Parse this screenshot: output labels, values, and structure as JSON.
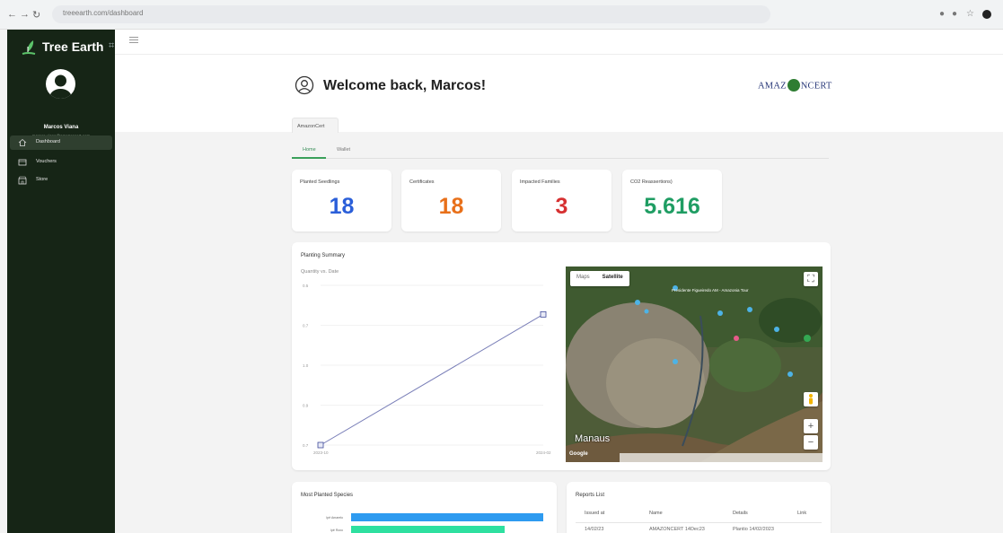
{
  "browser": {
    "url": "treeearth.com/dashboard"
  },
  "sidebar": {
    "app_name": "Tree Earth",
    "user_name": "Marcos Viana",
    "user_email": "marcos.viana@amazoncert.com",
    "items": [
      {
        "label": "Dashboard",
        "icon": "home-icon",
        "active": true
      },
      {
        "label": "Vouchers",
        "icon": "voucher-icon",
        "active": false
      },
      {
        "label": "Store",
        "icon": "store-icon",
        "active": false
      }
    ]
  },
  "header": {
    "welcome": "Welcome back, Marcos!",
    "company_logo_left": "AMAZ",
    "company_logo_right": "NCERT",
    "company_tab": "AmazonCert"
  },
  "tabs": [
    "Home",
    "Wallet"
  ],
  "stats": [
    {
      "label": "Planted Seedlings",
      "value": "18",
      "color": "#2b5fd9"
    },
    {
      "label": "Certificates",
      "value": "18",
      "color": "#e8701a"
    },
    {
      "label": "Impacted Families",
      "value": "3",
      "color": "#d63031"
    },
    {
      "label": "CO2 Reassertions)",
      "value": "5.616",
      "color": "#1f9d63"
    }
  ],
  "planting_summary": {
    "title": "Planting Summary",
    "chart_subtitle": "Quantity vs. Date"
  },
  "chart_data": {
    "type": "line",
    "title": "Quantity vs. Date",
    "x": [
      "2023-10",
      "2024-02"
    ],
    "y_ticks": [
      "0.5",
      "0.7",
      "1.0",
      "0.9",
      "0.7"
    ],
    "series": [
      {
        "values": [
          0,
          18
        ]
      }
    ],
    "ylim": [
      0,
      22
    ],
    "grid": true
  },
  "map": {
    "map_label": "Maps",
    "satellite_label": "Satellite",
    "city_label": "Manaus",
    "google_label": "Google",
    "places": [
      "Presidente Figueiredo AM - Amazonia Tour",
      "Manaus"
    ]
  },
  "species": {
    "title": "Most Planted Species",
    "bars": [
      {
        "label": "Ipê Amarelo",
        "value": 10,
        "color": "#2e9bf0"
      },
      {
        "label": "Ipê Roxo",
        "value": 8,
        "color": "#2ee0a0"
      }
    ]
  },
  "reports": {
    "title": "Reports List",
    "columns": [
      "Issued at",
      "Name",
      "Details",
      "Link"
    ],
    "rows": [
      {
        "issued": "14/02/23",
        "name": "AMAZONCERT 14Dec23",
        "details": "Plantio 14/02/2023",
        "link": ""
      }
    ]
  }
}
